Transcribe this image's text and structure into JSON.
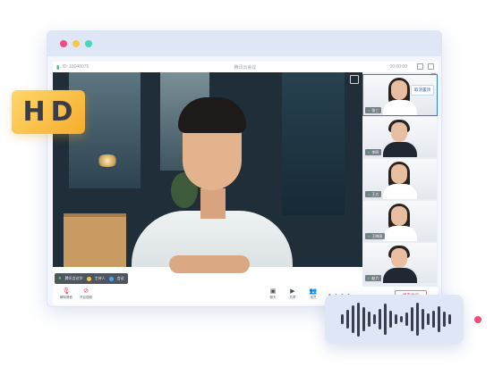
{
  "badge": {
    "text": "HD"
  },
  "window": {
    "controls": [
      "close",
      "minimize",
      "maximize"
    ],
    "colors": {
      "close": "#f24c7c",
      "minimize": "#f7c64a",
      "maximize": "#47d6bf",
      "accent": "#2f80ed"
    }
  },
  "meeting": {
    "meeting_id": "ID: 16040075",
    "title": "腾讯云会议",
    "timer": "00:00:00",
    "speaker_tag": {
      "name": "腾讯会议学",
      "chip1": "主持人",
      "chip2": "会议"
    },
    "participants": [
      {
        "name": "张三",
        "button": "取消置顶"
      },
      {
        "name": "李四"
      },
      {
        "name": "王五"
      },
      {
        "name": "王晓丽"
      },
      {
        "name": "赵六"
      }
    ]
  },
  "toolbar": {
    "left": [
      {
        "label": "解除静音",
        "icon": "mic-muted-icon"
      },
      {
        "label": "开启视频",
        "icon": "camera-off-icon"
      }
    ],
    "center": [
      {
        "label": "聊天",
        "icon": "chat-icon"
      },
      {
        "label": "共享",
        "icon": "screen-share-icon"
      },
      {
        "label": "成员",
        "icon": "members-icon"
      }
    ],
    "more": "• • • •",
    "end_button": "结束会议"
  },
  "voice_wave": {
    "bars": [
      0.3,
      0.55,
      0.8,
      1.0,
      0.7,
      0.45,
      0.3,
      0.6,
      0.9,
      0.5,
      0.3,
      0.2,
      0.4,
      0.7,
      0.95,
      0.6,
      0.35,
      0.5,
      0.75,
      0.45,
      0.3
    ]
  }
}
